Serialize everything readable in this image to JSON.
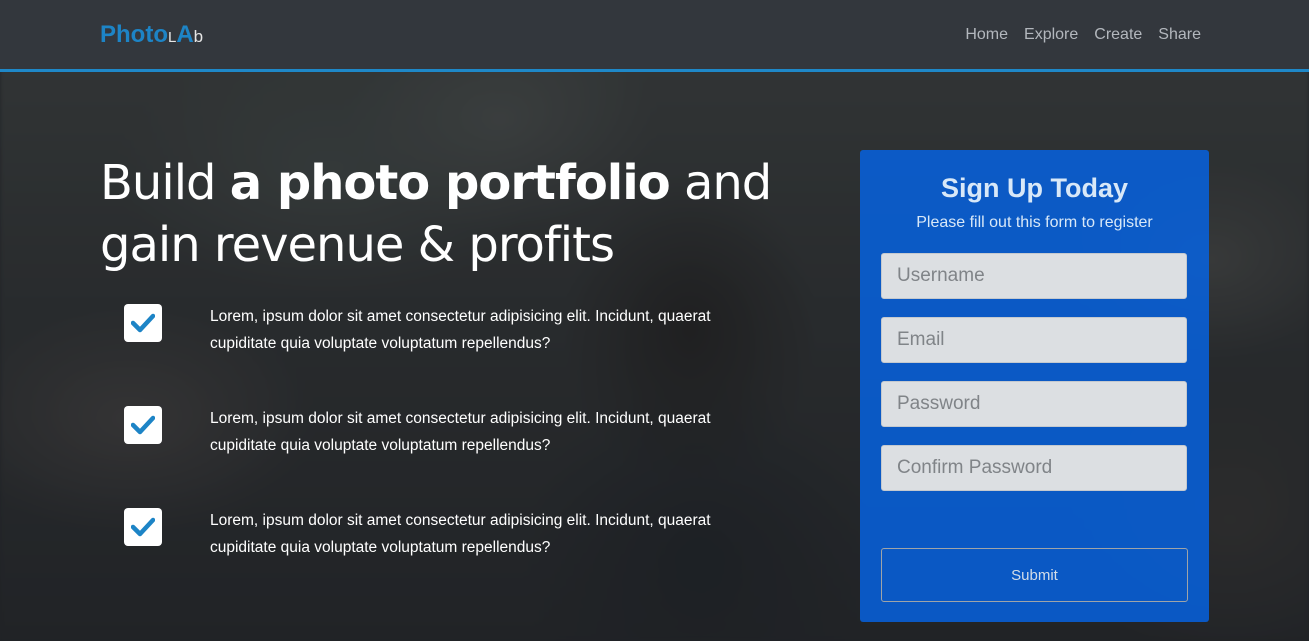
{
  "brand": {
    "part1": "Photo",
    "part2": "L",
    "part3": "A",
    "part4": "b"
  },
  "nav": {
    "items": [
      {
        "label": "Home"
      },
      {
        "label": "Explore"
      },
      {
        "label": "Create"
      },
      {
        "label": "Share"
      }
    ]
  },
  "hero": {
    "title_pre": "Build ",
    "title_bold": "a photo portfolio",
    "title_post": " and gain revenue & profits",
    "features": [
      {
        "text": "Lorem, ipsum dolor sit amet consectetur adipisicing elit. Incidunt, quaerat cupiditate quia voluptate voluptatum repellendus?"
      },
      {
        "text": "Lorem, ipsum dolor sit amet consectetur adipisicing elit. Incidunt, quaerat cupiditate quia voluptate voluptatum repellendus?"
      },
      {
        "text": "Lorem, ipsum dolor sit amet consectetur adipisicing elit. Incidunt, quaerat cupiditate quia voluptate voluptatum repellendus?"
      }
    ]
  },
  "signup": {
    "title": "Sign Up Today",
    "subtitle": "Please fill out this form to register",
    "fields": {
      "username": {
        "placeholder": "Username",
        "value": ""
      },
      "email": {
        "placeholder": "Email",
        "value": ""
      },
      "password": {
        "placeholder": "Password",
        "value": ""
      },
      "confirm": {
        "placeholder": "Confirm Password",
        "value": ""
      }
    },
    "submit_label": "Submit"
  },
  "colors": {
    "accent": "#1d84c6",
    "navbar": "#33373d",
    "card": "#0564e6",
    "check": "#1d84c6"
  },
  "icons": {
    "feature_icon": "check-icon"
  }
}
